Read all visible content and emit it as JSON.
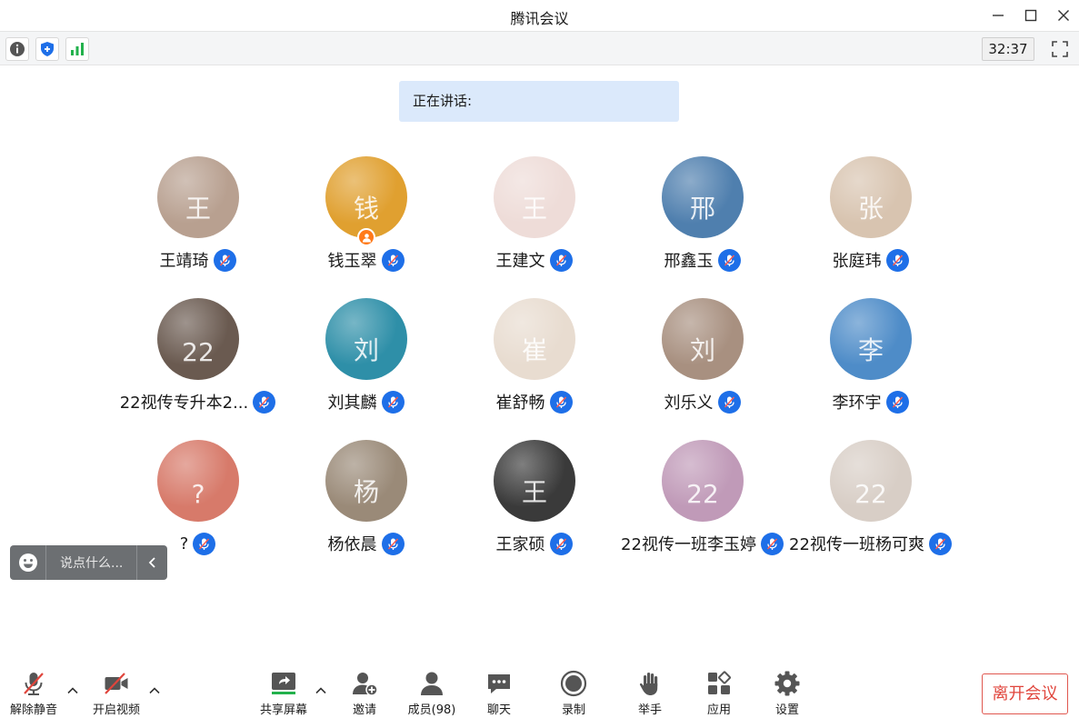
{
  "window": {
    "title": "腾讯会议"
  },
  "infobar": {
    "timer": "32:37"
  },
  "speaking": {
    "label": "正在讲话:"
  },
  "participants": [
    {
      "name": "王靖琦",
      "bg": "#b8a090",
      "initial": "王"
    },
    {
      "name": "钱玉翠",
      "bg": "#e0a030",
      "initial": "钱",
      "host": true
    },
    {
      "name": "王建文",
      "bg": "#eedcd8",
      "initial": "王"
    },
    {
      "name": "邢鑫玉",
      "bg": "#4f7fae",
      "initial": "邢"
    },
    {
      "name": "张庭玮",
      "bg": "#d8c4b0",
      "initial": "张"
    },
    {
      "name": "22视传专升本2...",
      "bg": "#6a5a50",
      "initial": "22"
    },
    {
      "name": "刘其麟",
      "bg": "#2e8fa8",
      "initial": "刘"
    },
    {
      "name": "崔舒畅",
      "bg": "#e8dcd0",
      "initial": "崔"
    },
    {
      "name": "刘乐义",
      "bg": "#a89080",
      "initial": "刘"
    },
    {
      "name": "李环宇",
      "bg": "#4e8cc8",
      "initial": "李"
    },
    {
      "name": "?",
      "bg": "#d77a6a",
      "initial": "?"
    },
    {
      "name": "杨依晨",
      "bg": "#9a8a78",
      "initial": "杨"
    },
    {
      "name": "王家硕",
      "bg": "#3a3a3a",
      "initial": "王"
    },
    {
      "name": "22视传一班李玉婷",
      "bg": "#c09ab8",
      "initial": "22"
    },
    {
      "name": "22视传一班杨可爽",
      "bg": "#d8cec6",
      "initial": "22"
    }
  ],
  "chat_popup": {
    "placeholder": "说点什么..."
  },
  "toolbar": {
    "unmute": "解除静音",
    "start_video": "开启视频",
    "share_screen": "共享屏幕",
    "invite": "邀请",
    "members": "成员(98)",
    "chat": "聊天",
    "record": "录制",
    "raise_hand": "举手",
    "apps": "应用",
    "settings": "设置",
    "leave": "离开会议"
  },
  "colors": {
    "accent_blue": "#1e6fe8",
    "leave_red": "#e0453c",
    "share_green": "#22b14c",
    "host_orange": "#ff7a1a",
    "speaking_bg": "#dbe9fb"
  },
  "icons": {
    "info": "info-icon",
    "security": "shield-icon",
    "network": "signal-bars-icon",
    "fullscreen": "fullscreen-icon",
    "emoji": "emoji-icon",
    "mic_muted": "mic-muted-icon",
    "video_off": "video-off-icon",
    "share": "share-screen-icon",
    "invite": "add-person-icon",
    "members": "members-icon",
    "chat": "chat-bubble-icon",
    "record": "record-icon",
    "hand": "hand-icon",
    "apps": "apps-grid-icon",
    "settings": "gear-icon"
  }
}
